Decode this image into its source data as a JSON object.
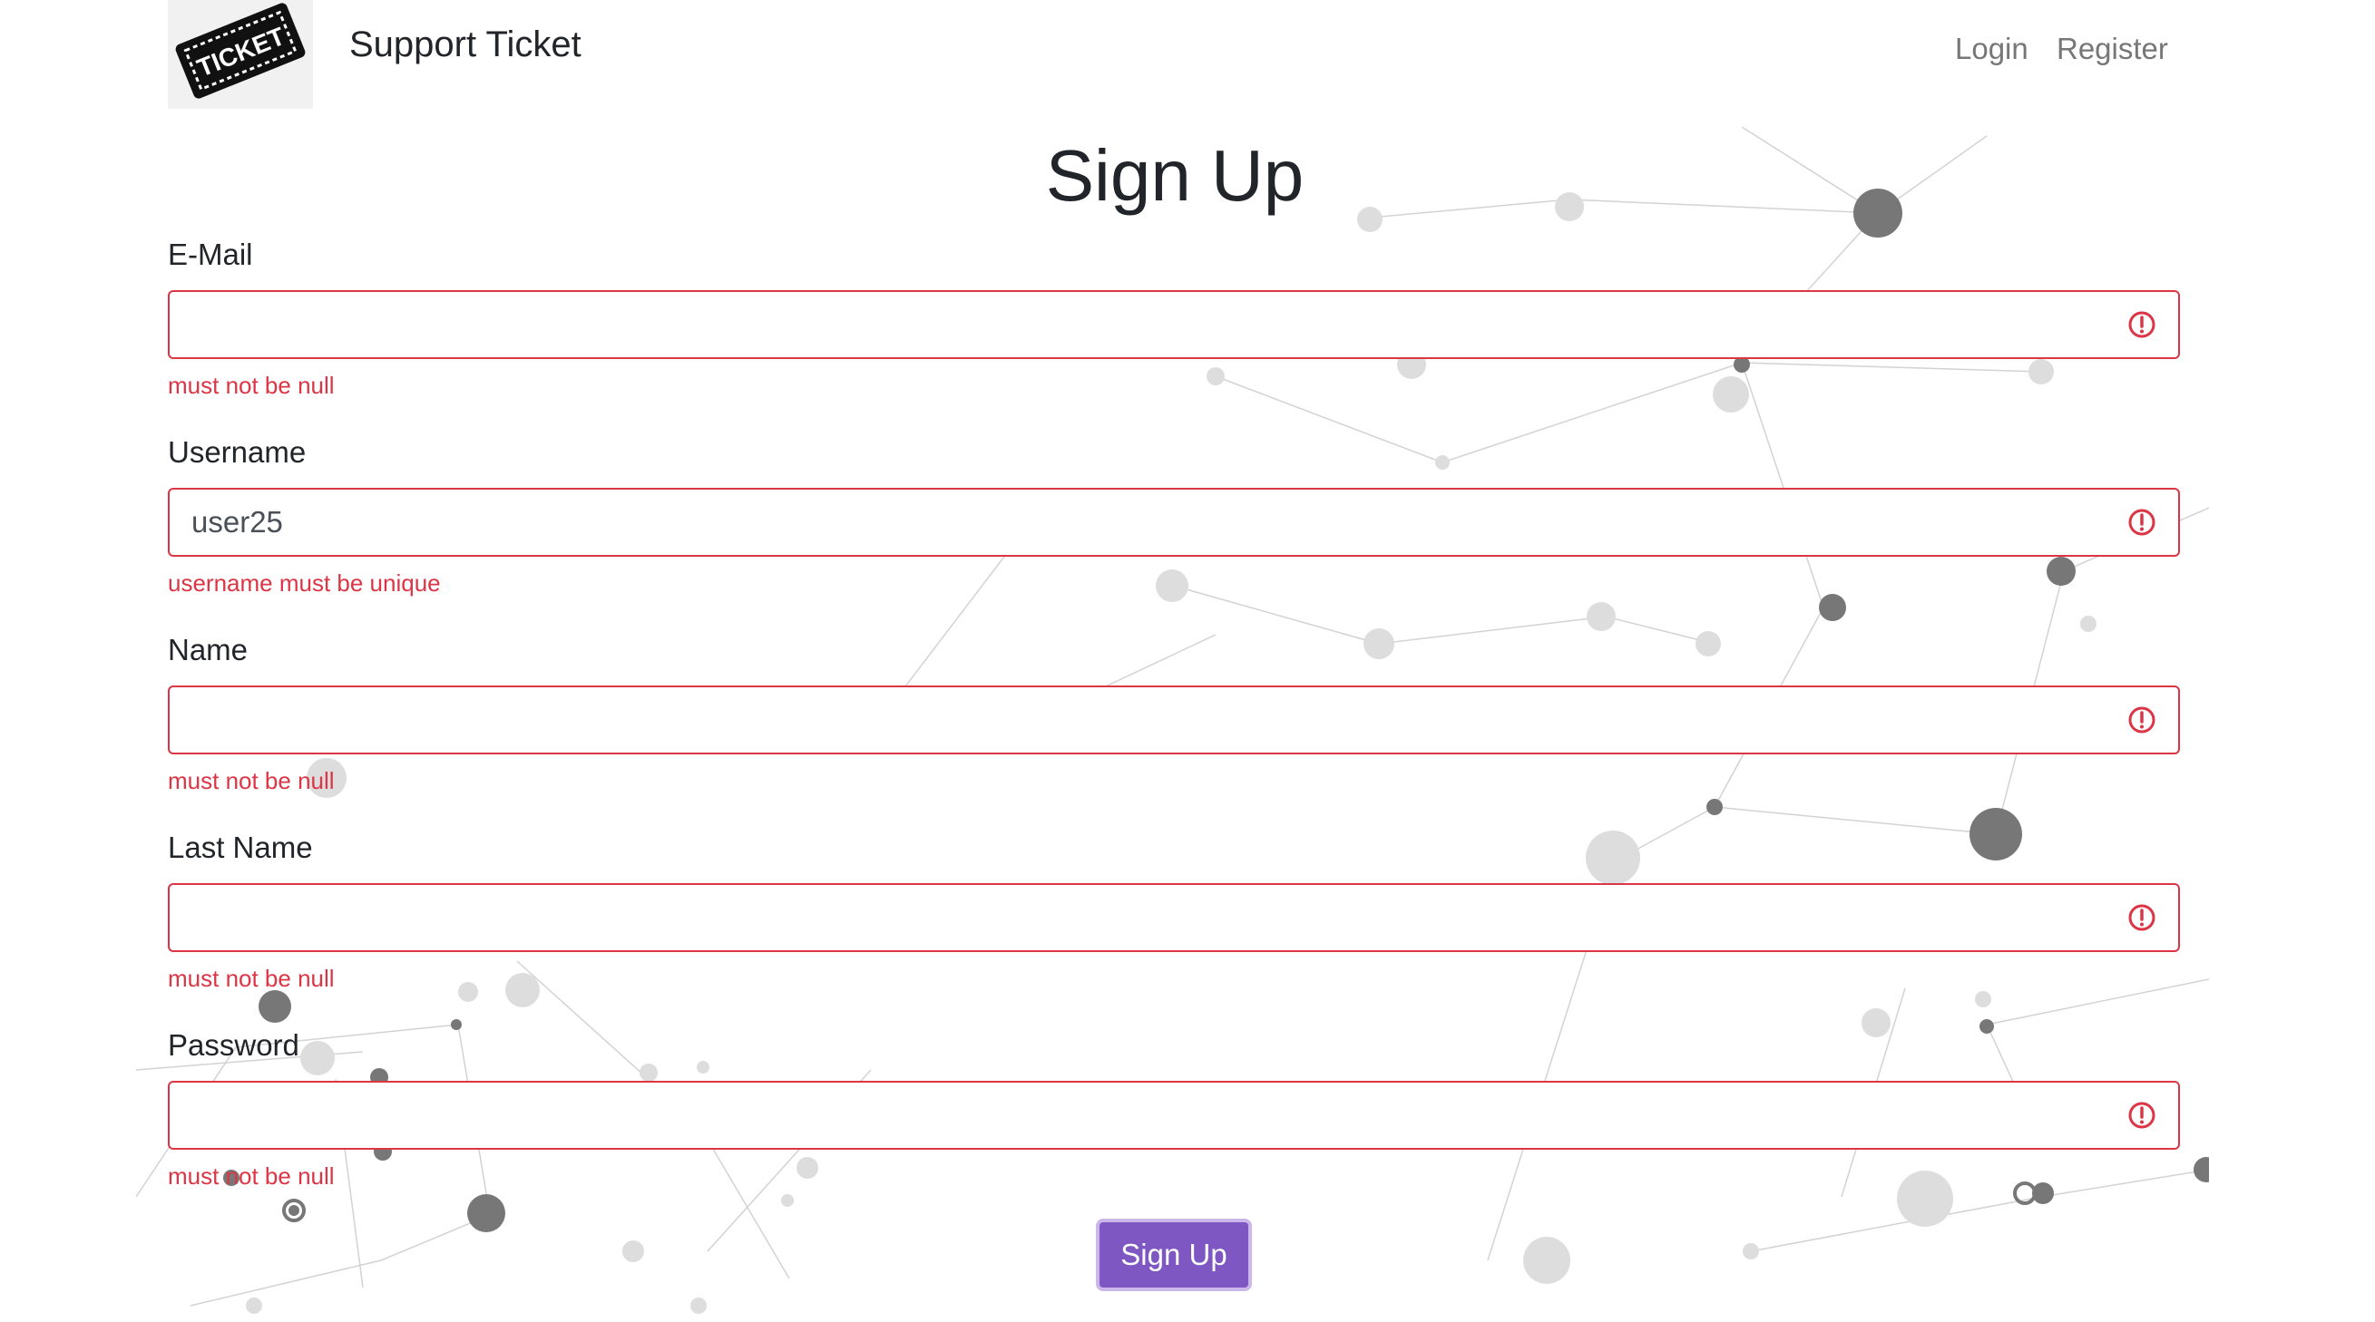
{
  "header": {
    "logo_text": "TICKET",
    "brand": "Support Ticket",
    "nav": {
      "login": "Login",
      "register": "Register"
    }
  },
  "page": {
    "title": "Sign Up"
  },
  "form": {
    "fields": [
      {
        "label": "E-Mail",
        "value": "",
        "error": "must not be null"
      },
      {
        "label": "Username",
        "value": "user25",
        "error": "username must be unique"
      },
      {
        "label": "Name",
        "value": "",
        "error": "must not be null"
      },
      {
        "label": "Last Name",
        "value": "",
        "error": "must not be null"
      },
      {
        "label": "Password",
        "value": "",
        "error": "must not be null"
      }
    ],
    "submit_label": "Sign Up"
  },
  "colors": {
    "error": "#dc3545",
    "accent": "#7e57c2",
    "nav_link": "#777777",
    "text": "#212529"
  },
  "icons": {
    "logo": "ticket-icon",
    "field_error": "exclamation-circle-icon"
  }
}
